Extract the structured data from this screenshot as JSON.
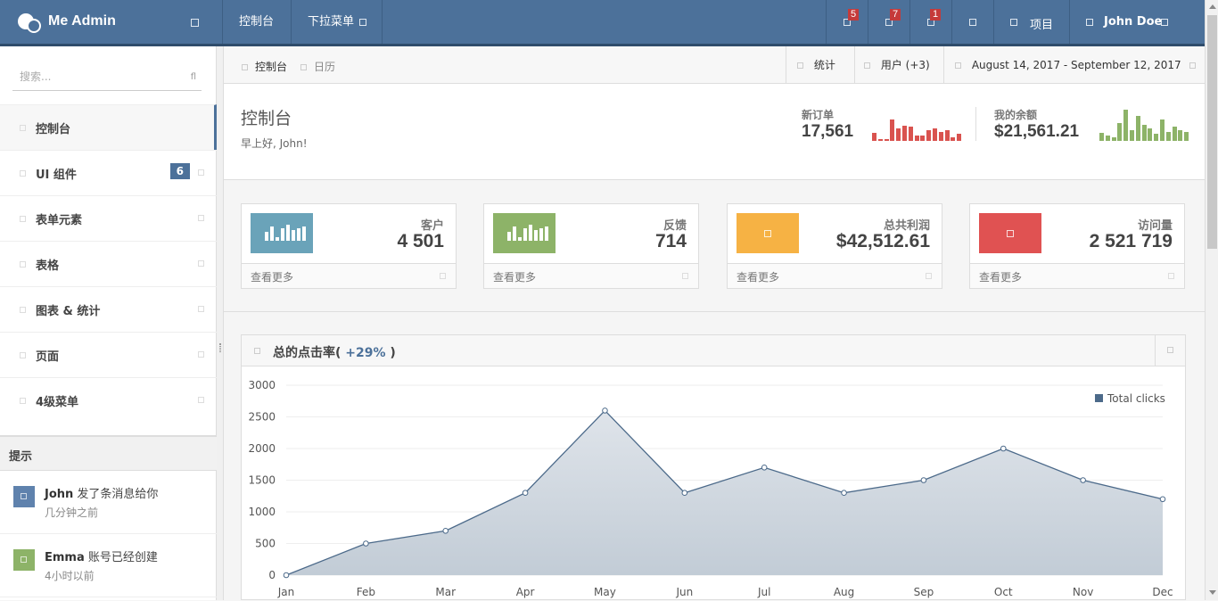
{
  "app": {
    "name": "Me Admin"
  },
  "topnav": {
    "dashboard": "控制台",
    "dropdown": "下拉菜单",
    "badges": {
      "tasks": "5",
      "messages": "7",
      "alerts": "1"
    },
    "projects": "项目",
    "user": "John Doe"
  },
  "sidebar": {
    "search_placeholder": "搜索...",
    "search_icon": "fl",
    "items": [
      {
        "label": "控制台",
        "icon": "dashboard-icon"
      },
      {
        "label": "UI 组件",
        "count": "6"
      },
      {
        "label": "表单元素"
      },
      {
        "label": "表格"
      },
      {
        "label": "图表 & 统计"
      },
      {
        "label": "页面"
      },
      {
        "label": "4级菜单"
      }
    ],
    "tips_title": "提示",
    "tips": [
      {
        "name": "John",
        "text": "发了条消息给你",
        "time": "几分钟之前",
        "color": "#5f82ad"
      },
      {
        "name": "Emma",
        "text": "账号已经创建",
        "time": "4小时以前",
        "color": "#8db368"
      }
    ]
  },
  "breadcrumb": {
    "home": "控制台",
    "calendar": "日历"
  },
  "toolbar": {
    "stats": "统计",
    "users": "用户 (+3)",
    "daterange": "August 14, 2017 - September 12, 2017"
  },
  "header": {
    "title": "控制台",
    "greeting": "早上好, John!",
    "new_orders": {
      "label": "新订单",
      "value": "17,561",
      "color": "#d9534f"
    },
    "balance": {
      "label": "我的余额",
      "value": "$21,561.21",
      "color": "#8db368"
    }
  },
  "cards": [
    {
      "label": "客户",
      "value": "4 501",
      "color": "#6aa3b9",
      "more": "查看更多"
    },
    {
      "label": "反馈",
      "value": "714",
      "color": "#8db368",
      "more": "查看更多"
    },
    {
      "label": "总共利润",
      "value": "$42,512.61",
      "color": "#f6b244",
      "more": "查看更多"
    },
    {
      "label": "访问量",
      "value": "2 521 719",
      "color": "#e05252",
      "more": "查看更多"
    }
  ],
  "panel": {
    "title": "总的点击率(",
    "change": "+29%",
    "close": ")"
  },
  "chart_data": {
    "type": "area",
    "categories": [
      "Jan",
      "Feb",
      "Mar",
      "Apr",
      "May",
      "Jun",
      "Jul",
      "Aug",
      "Sep",
      "Oct",
      "Nov",
      "Dec"
    ],
    "series": [
      {
        "name": "Total clicks",
        "values": [
          0,
          500,
          700,
          1300,
          2600,
          1300,
          1700,
          1300,
          1500,
          2000,
          1500,
          1200
        ],
        "color": "#4c6a8a"
      }
    ],
    "ylim": [
      0,
      3000
    ],
    "yticks": [
      0,
      500,
      1000,
      1500,
      2000,
      2500,
      3000
    ],
    "legend": "top-right",
    "grid": true
  }
}
